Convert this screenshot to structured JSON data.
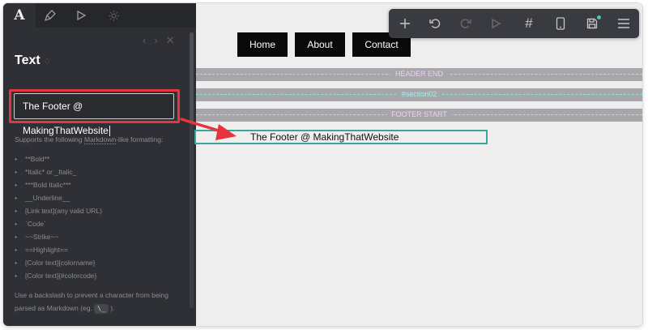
{
  "panel": {
    "tabs": [
      {
        "name": "text-tab",
        "icon": "A"
      },
      {
        "name": "style-tab",
        "icon": "paint-brush-icon"
      },
      {
        "name": "preview-tab",
        "icon": "play-icon"
      },
      {
        "name": "settings-tab",
        "icon": "gear-icon"
      }
    ],
    "title": "Text",
    "text_value": "The Footer @ MakingThatWebsite",
    "help_intro_prefix": "Supports the following ",
    "help_intro_link": "Markdown",
    "help_intro_suffix": "-like formatting:",
    "help_items": [
      "**Bold**",
      "*Italic* or _Italic_",
      "***Bold Italic***",
      "__Underline__",
      "[Link text](any valid URL)",
      "`Code`",
      "~~Strike~~",
      "==Highlight==",
      "[Color text]{colorname}",
      "[Color text]{#colorcode}"
    ],
    "help_footer_prefix": "Use a backslash to prevent a character from being parsed as Markdown (eg. ",
    "help_footer_key": "\\_",
    "help_footer_suffix": ")."
  },
  "canvas": {
    "nav": {
      "home": "Home",
      "about": "About",
      "contact": "Contact"
    },
    "dividers": {
      "header_end": "HEADER END",
      "section": "#section02",
      "footer_start": "FOOTER START"
    },
    "footer_text": "The Footer @ MakingThatWebsite"
  },
  "toolbar": {
    "icons": [
      "plus-icon",
      "undo-icon",
      "redo-icon",
      "play-icon",
      "grid-hash-icon",
      "mobile-icon",
      "save-icon",
      "menu-icon"
    ]
  },
  "colors": {
    "panel_bg": "#2f3035",
    "highlight_red": "#e8343f",
    "selection_teal": "#3aa697",
    "divider_bg": "#a7a6aa",
    "label_pink": "#f3cdf7",
    "label_teal": "#a5f0ea"
  }
}
